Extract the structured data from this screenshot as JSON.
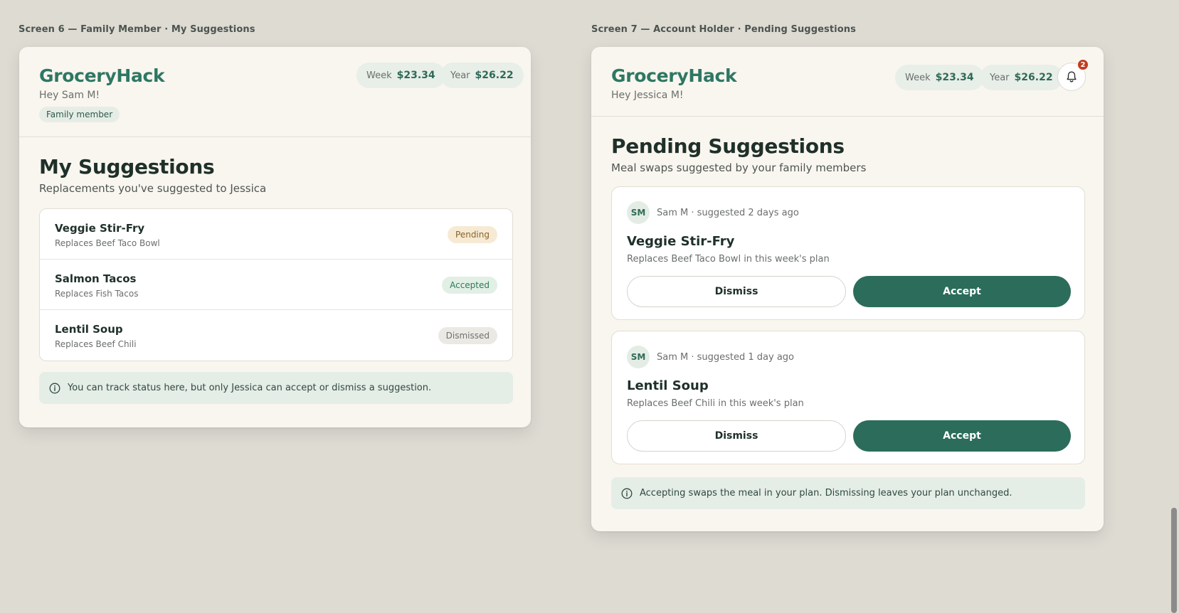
{
  "screen6": {
    "label": "Screen 6 — Family Member · My Suggestions",
    "brand": "GroceryHack",
    "greeting": "Hey Sam M!",
    "role_badge": "Family member",
    "week_label": "Week",
    "week_value": "$23.34",
    "year_label": "Year",
    "year_value": "$26.22",
    "title": "My Suggestions",
    "subtitle": "Replacements you've suggested to Jessica",
    "suggestions": [
      {
        "name": "Veggie Stir-Fry",
        "replaces": "Replaces Beef Taco Bowl",
        "status": "Pending"
      },
      {
        "name": "Salmon Tacos",
        "replaces": "Replaces Fish Tacos",
        "status": "Accepted"
      },
      {
        "name": "Lentil Soup",
        "replaces": "Replaces Beef Chili",
        "status": "Dismissed"
      }
    ],
    "info": "You can track status here, but only Jessica can accept or dismiss a suggestion."
  },
  "screen7": {
    "label": "Screen 7 — Account Holder · Pending Suggestions",
    "brand": "GroceryHack",
    "greeting": "Hey Jessica M!",
    "week_label": "Week",
    "week_value": "$23.34",
    "year_label": "Year",
    "year_value": "$26.22",
    "notification_count": "2",
    "title": "Pending Suggestions",
    "subtitle": "Meal swaps suggested by your family members",
    "cards": [
      {
        "initials": "SM",
        "meta": "Sam M · suggested 2 days ago",
        "name": "Veggie Stir-Fry",
        "replaces": "Replaces Beef Taco Bowl in this week's plan",
        "dismiss": "Dismiss",
        "accept": "Accept"
      },
      {
        "initials": "SM",
        "meta": "Sam M · suggested 1 day ago",
        "name": "Lentil Soup",
        "replaces": "Replaces Beef Chili in this week's plan",
        "dismiss": "Dismiss",
        "accept": "Accept"
      }
    ],
    "info": "Accepting swaps the meal in your plan. Dismissing leaves your plan unchanged."
  },
  "colors": {
    "brand": "#2e7763",
    "accept_button": "#2b6c5a",
    "pending": "#8a6326",
    "accepted": "#2d7a57",
    "notification_badge": "#c23b22"
  },
  "icons": {
    "info": "info-circle-icon",
    "bell": "bell-icon"
  }
}
